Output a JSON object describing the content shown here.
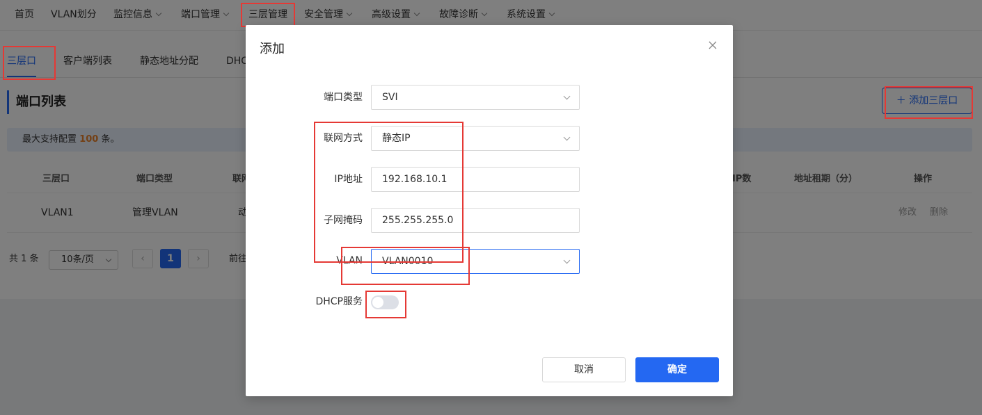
{
  "nav": {
    "items": [
      {
        "label": "首页",
        "dropdown": false
      },
      {
        "label": "VLAN划分",
        "dropdown": false
      },
      {
        "label": "监控信息",
        "dropdown": true
      },
      {
        "label": "端口管理",
        "dropdown": true
      },
      {
        "label": "三层管理",
        "dropdown": false,
        "active": true
      },
      {
        "label": "安全管理",
        "dropdown": true
      },
      {
        "label": "高级设置",
        "dropdown": true
      },
      {
        "label": "故障诊断",
        "dropdown": true
      },
      {
        "label": "系统设置",
        "dropdown": true
      }
    ]
  },
  "subtabs": {
    "items": [
      {
        "label": "三层口",
        "active": true
      },
      {
        "label": "客户端列表"
      },
      {
        "label": "静态地址分配"
      },
      {
        "label": "DHCP"
      }
    ]
  },
  "page": {
    "section_title": "端口列表",
    "add_button": "添加三层口",
    "notice_prefix": "最大支持配置",
    "notice_count": "100",
    "notice_suffix": "条。"
  },
  "table": {
    "headers": [
      "三层口",
      "端口类型",
      "联网",
      "IP数",
      "地址租期（分）",
      "操作"
    ],
    "row": {
      "port": "VLAN1",
      "type": "管理VLAN",
      "mode": "动",
      "actions": [
        "修改",
        "删除"
      ]
    }
  },
  "pager": {
    "total": "共 1 条",
    "page_size": "10条/页",
    "current": "1",
    "prev": "‹",
    "next": "›",
    "goto": "前往"
  },
  "modal": {
    "title": "添加",
    "close": "×",
    "fields": {
      "port_type": {
        "label": "端口类型",
        "value": "SVI"
      },
      "net_mode": {
        "label": "联网方式",
        "value": "静态IP"
      },
      "ip": {
        "label": "IP地址",
        "value": "192.168.10.1"
      },
      "mask": {
        "label": "子网掩码",
        "value": "255.255.255.0"
      },
      "vlan": {
        "label": "VLAN",
        "value": "VLAN0010"
      },
      "dhcp": {
        "label": "DHCP服务",
        "enabled": false
      }
    },
    "cancel": "取消",
    "ok": "确定"
  },
  "colors": {
    "accent": "#2468f2",
    "highlight": "#e53935",
    "notice_count": "#e6802a"
  }
}
